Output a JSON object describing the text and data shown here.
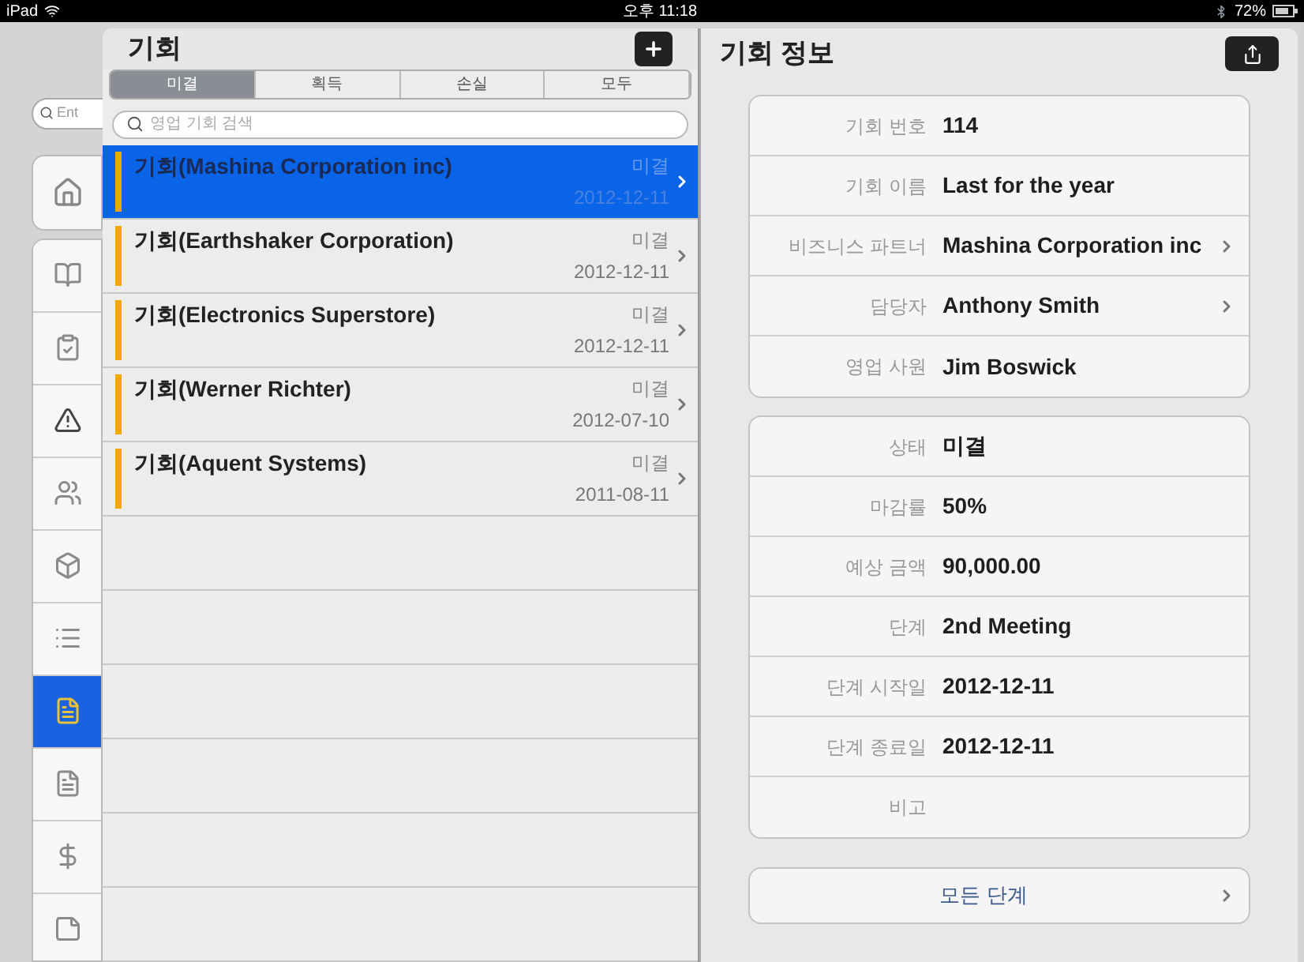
{
  "status_bar": {
    "device": "iPad",
    "time": "오후 11:18",
    "battery": "72%"
  },
  "sidebar": {
    "search": {
      "placeholder": "Ent"
    },
    "home": {
      "selected": false
    },
    "items": [
      {
        "kind": "book",
        "selected": false
      },
      {
        "kind": "checklist",
        "selected": false
      },
      {
        "kind": "warning",
        "selected": false
      },
      {
        "kind": "contacts",
        "selected": false
      },
      {
        "kind": "box",
        "selected": false
      },
      {
        "kind": "list",
        "selected": false
      },
      {
        "kind": "money-doc",
        "selected": true
      },
      {
        "kind": "doc-dollar",
        "selected": false
      },
      {
        "kind": "dollar",
        "selected": false
      },
      {
        "kind": "notes",
        "selected": false
      }
    ]
  },
  "list_panel": {
    "title": "기회",
    "tabs": [
      {
        "label": "미결",
        "selected": true
      },
      {
        "label": "획득",
        "selected": false
      },
      {
        "label": "손실",
        "selected": false
      },
      {
        "label": "모두",
        "selected": false
      }
    ],
    "search": {
      "placeholder": "영업 기회 검색"
    },
    "rows": [
      {
        "title": "기회(Mashina Corporation inc)",
        "status": "미결",
        "date": "2012-12-11",
        "selected": true
      },
      {
        "title": "기회(Earthshaker Corporation)",
        "status": "미결",
        "date": "2012-12-11",
        "selected": false
      },
      {
        "title": "기회(Electronics Superstore)",
        "status": "미결",
        "date": "2012-12-11",
        "selected": false
      },
      {
        "title": "기회(Werner Richter)",
        "status": "미결",
        "date": "2012-07-10",
        "selected": false
      },
      {
        "title": "기회(Aquent Systems)",
        "status": "미결",
        "date": "2011-08-11",
        "selected": false
      }
    ]
  },
  "detail_panel": {
    "title": "기회 정보",
    "groups": [
      [
        {
          "label": "기회 번호",
          "value": "114",
          "link": false
        },
        {
          "label": "기회 이름",
          "value": "Last for the year",
          "link": false
        },
        {
          "label": "비즈니스 파트너",
          "value": "Mashina Corporation inc",
          "link": true
        },
        {
          "label": "담당자",
          "value": "Anthony Smith",
          "link": true
        },
        {
          "label": "영업 사원",
          "value": "Jim Boswick",
          "link": false
        }
      ],
      [
        {
          "label": "상태",
          "value": "미결",
          "link": false
        },
        {
          "label": "마감률",
          "value": "50%",
          "link": false
        },
        {
          "label": "예상 금액",
          "value": "90,000.00",
          "link": false
        },
        {
          "label": "단계",
          "value": "2nd Meeting",
          "link": false
        },
        {
          "label": "단계 시작일",
          "value": "2012-12-11",
          "link": false
        },
        {
          "label": "단계 종료일",
          "value": "2012-12-11",
          "link": false
        },
        {
          "label": "비고",
          "link": false
        }
      ]
    ],
    "button": "모든 단계"
  }
}
